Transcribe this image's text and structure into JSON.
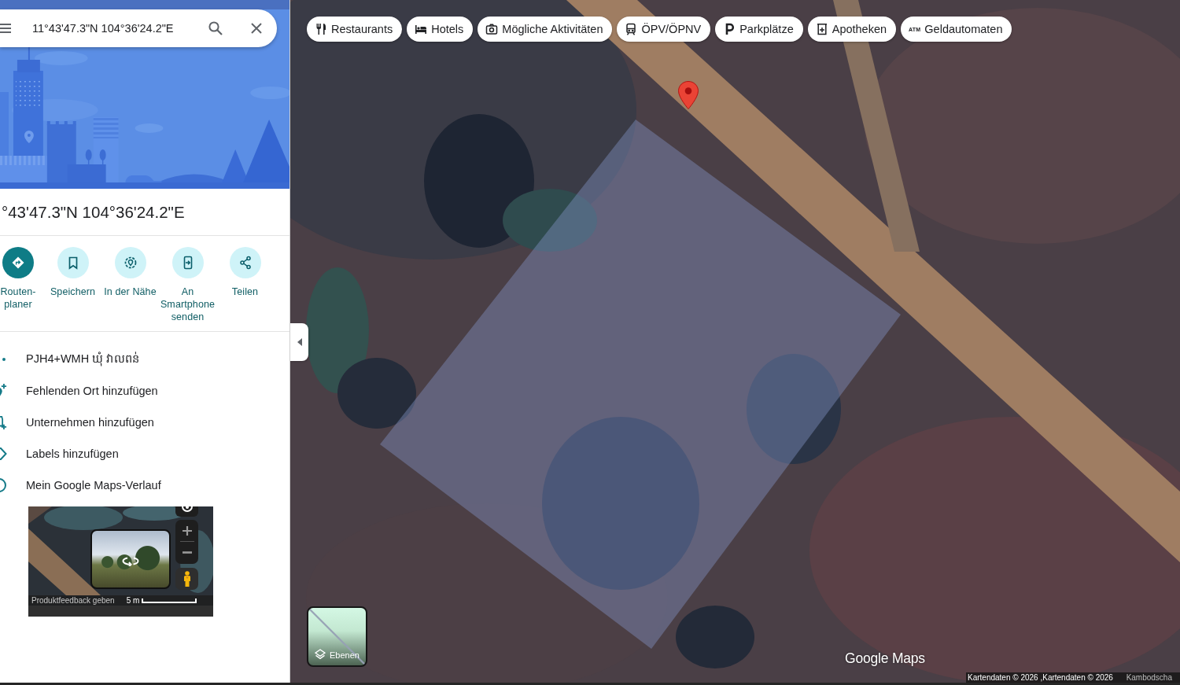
{
  "search": {
    "value": "11°43'47.3\"N 104°36'24.2\"E"
  },
  "place": {
    "title": "°43'47.3\"N 104°36'24.2\"E"
  },
  "actions": [
    {
      "kind": "directions",
      "label": "Routen-planer",
      "primary": true
    },
    {
      "kind": "save",
      "label": "Speichern",
      "primary": false
    },
    {
      "kind": "nearby",
      "label": "In der Nähe",
      "primary": false
    },
    {
      "kind": "send",
      "label": "An Smartphone senden",
      "primary": false
    },
    {
      "kind": "share",
      "label": "Teilen",
      "primary": false
    }
  ],
  "details": [
    {
      "kind": "plus_code",
      "text": "PJH4+WMH ឃុំ វាលពន់"
    },
    {
      "kind": "add_place",
      "text": "Fehlenden Ort hinzufügen"
    },
    {
      "kind": "add_business",
      "text": "Unternehmen hinzufügen"
    },
    {
      "kind": "add_label",
      "text": "Labels hinzufügen"
    },
    {
      "kind": "history",
      "text": "Mein Google Maps-Verlauf"
    }
  ],
  "street_view": {
    "feedback": "Produktfeedback geben",
    "scale": "5 m"
  },
  "categories": [
    {
      "kind": "restaurant",
      "label": "Restaurants"
    },
    {
      "kind": "hotel",
      "label": "Hotels"
    },
    {
      "kind": "activity",
      "label": "Mögliche Aktivitäten"
    },
    {
      "kind": "transit",
      "label": "ÖPV/ÖPNV"
    },
    {
      "kind": "parking",
      "label": "Parkplätze"
    },
    {
      "kind": "pharmacy",
      "label": "Apotheken"
    },
    {
      "kind": "atm",
      "label": "Geldautomaten",
      "icon_text": "ATM"
    }
  ],
  "layers_button": {
    "label": "Ebenen"
  },
  "map": {
    "logo": "Google Maps",
    "attribution": "Kartendaten © 2026 ,Kartendaten © 2026",
    "region": "Kambodscha"
  }
}
